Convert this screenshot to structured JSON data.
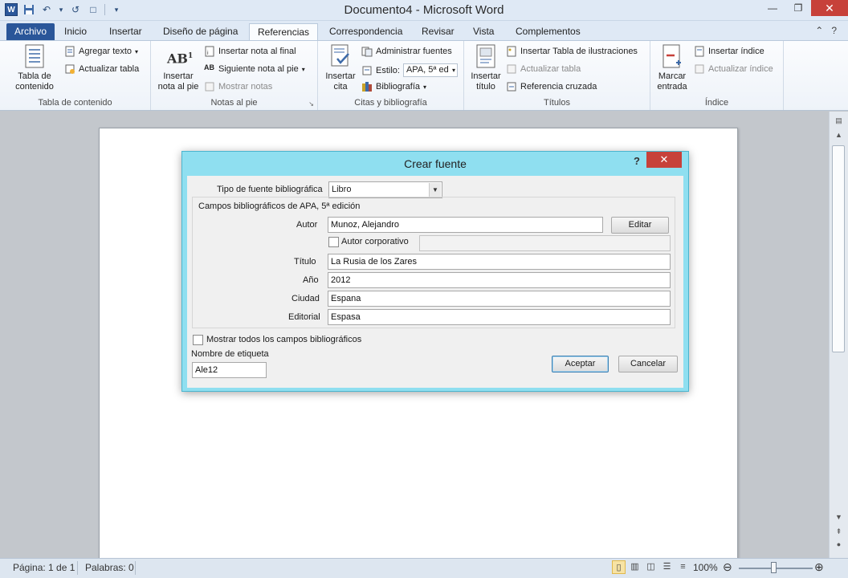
{
  "window": {
    "title": "Documento4 - Microsoft Word",
    "min": "—",
    "restore": "❐",
    "close": "✕"
  },
  "qat": {
    "app_icon": "W",
    "save": "💾",
    "undo": "↶",
    "redo": "↺",
    "new": "□",
    "more": "▾"
  },
  "tabs": {
    "file": "Archivo",
    "items": [
      "Inicio",
      "Insertar",
      "Diseño de página",
      "Referencias",
      "Correspondencia",
      "Revisar",
      "Vista",
      "Complementos"
    ],
    "active": "Referencias",
    "help": "?",
    "collapse": "⌃"
  },
  "ribbon": {
    "toc": {
      "label": "Tabla de contenido",
      "big_button": "Tabla de contenido",
      "add_text": "Agregar texto",
      "update_table": "Actualizar tabla"
    },
    "footnotes": {
      "label": "Notas al pie",
      "insert_footnote": "Insertar nota al pie",
      "insert_endnote": "Insertar nota al final",
      "next_footnote": "Siguiente nota al pie",
      "show_notes": "Mostrar notas"
    },
    "citations": {
      "label": "Citas y bibliografía",
      "insert_citation": "Insertar cita",
      "manage_sources": "Administrar fuentes",
      "style_label": "Estilo:",
      "style_value": "APA, 5ª ed",
      "bibliography": "Bibliografía"
    },
    "captions": {
      "label": "Títulos",
      "insert_caption": "Insertar título",
      "insert_table_figures": "Insertar Tabla de ilustraciones",
      "update_table": "Actualizar tabla",
      "cross_reference": "Referencia cruzada"
    },
    "index": {
      "label": "Índice",
      "mark_entry": "Marcar entrada",
      "insert_index": "Insertar índice",
      "update_index": "Actualizar índice"
    }
  },
  "dialog": {
    "title": "Crear fuente",
    "help": "?",
    "close": "✕",
    "source_type_label": "Tipo de fuente bibliográfica",
    "source_type_value": "Libro",
    "fields_group_label": "Campos bibliográficos de APA, 5ª edición",
    "author_label": "Autor",
    "author_value": "Munoz, Alejandro",
    "edit_button": "Editar",
    "corporate_author_label": "Autor corporativo",
    "corporate_author_checked": false,
    "title_label": "Título",
    "title_value": "La Rusia de los Zares",
    "year_label": "Año",
    "year_value": "2012",
    "city_label": "Ciudad",
    "city_value": "Espana",
    "publisher_label": "Editorial",
    "publisher_value": "Espasa",
    "show_all_label": "Mostrar todos los campos bibliográficos",
    "show_all_checked": false,
    "tag_name_label": "Nombre de etiqueta",
    "tag_name_value": "Ale12",
    "ok_button": "Aceptar",
    "cancel_button": "Cancelar"
  },
  "statusbar": {
    "page": "Página: 1 de 1",
    "words": "Palabras: 0",
    "zoom": "100%",
    "zoom_out": "⊖",
    "zoom_in": "⊕"
  },
  "colors": {
    "file_tab": "#2a5699",
    "dialog_frame": "#8fdff0",
    "close_button": "#c7413a"
  }
}
